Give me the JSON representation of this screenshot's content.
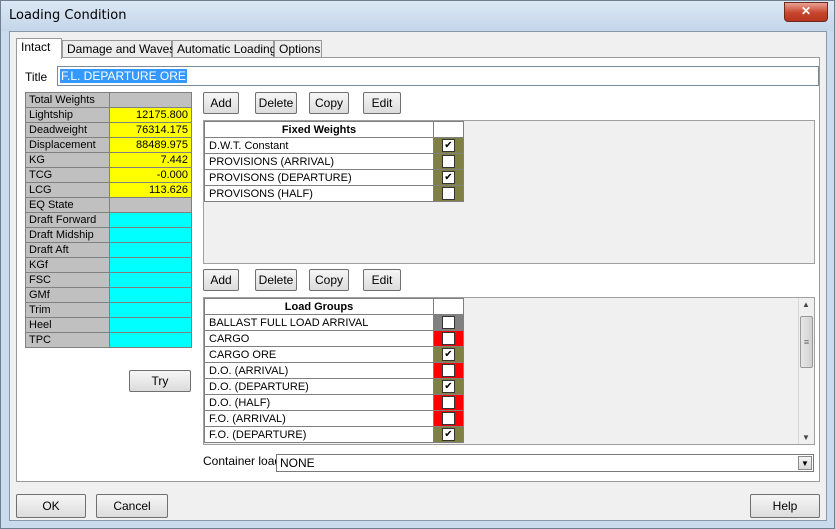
{
  "window": {
    "title": "Loading Condition",
    "close_label": "✕"
  },
  "tabs": [
    {
      "label": "Intact"
    },
    {
      "label": "Damage and Waves"
    },
    {
      "label": "Automatic Loading"
    },
    {
      "label": "Options"
    }
  ],
  "title_field": {
    "label": "Title",
    "value": "F.L. DEPARTURE ORE"
  },
  "weights": {
    "header": "Total Weights",
    "rows": [
      {
        "label": "Lightship",
        "value": "12175.800"
      },
      {
        "label": "Deadweight",
        "value": "76314.175"
      },
      {
        "label": "Displacement",
        "value": "88489.975"
      },
      {
        "label": "KG",
        "value": "7.442"
      },
      {
        "label": "TCG",
        "value": "-0.000"
      },
      {
        "label": "LCG",
        "value": "113.626"
      },
      {
        "label": "EQ State",
        "value": ""
      },
      {
        "label": "Draft Forward",
        "value": ""
      },
      {
        "label": "Draft Midship",
        "value": ""
      },
      {
        "label": "Draft Aft",
        "value": ""
      },
      {
        "label": "KGf",
        "value": ""
      },
      {
        "label": "FSC",
        "value": ""
      },
      {
        "label": "GMf",
        "value": ""
      },
      {
        "label": "Trim",
        "value": ""
      },
      {
        "label": "Heel",
        "value": ""
      },
      {
        "label": "TPC",
        "value": ""
      }
    ],
    "try_label": "Try"
  },
  "toolbar1": {
    "add": "Add",
    "delete": "Delete",
    "copy": "Copy",
    "edit": "Edit"
  },
  "toolbar2": {
    "add": "Add",
    "delete": "Delete",
    "copy": "Copy",
    "edit": "Edit"
  },
  "fixed_weights": {
    "header": "Fixed Weights",
    "rows": [
      {
        "name": "D.W.T. Constant",
        "checked": true,
        "color": "#808040"
      },
      {
        "name": "PROVISIONS (ARRIVAL)",
        "checked": false,
        "color": "#808040"
      },
      {
        "name": "PROVISONS (DEPARTURE)",
        "checked": true,
        "color": "#808040"
      },
      {
        "name": "PROVISONS (HALF)",
        "checked": false,
        "color": "#808040"
      }
    ]
  },
  "load_groups": {
    "header": "Load Groups",
    "rows": [
      {
        "name": "BALLAST FULL LOAD ARRIVAL",
        "checked": false,
        "color": "#808080"
      },
      {
        "name": "CARGO",
        "checked": false,
        "color": "#ff0000"
      },
      {
        "name": "CARGO ORE",
        "checked": true,
        "color": "#808040"
      },
      {
        "name": "D.O. (ARRIVAL)",
        "checked": false,
        "color": "#ff0000"
      },
      {
        "name": "D.O. (DEPARTURE)",
        "checked": true,
        "color": "#808040"
      },
      {
        "name": "D.O. (HALF)",
        "checked": false,
        "color": "#ff0000"
      },
      {
        "name": "F.O. (ARRIVAL)",
        "checked": false,
        "color": "#ff0000"
      },
      {
        "name": "F.O. (DEPARTURE)",
        "checked": true,
        "color": "#808040"
      }
    ]
  },
  "container_load": {
    "label": "Container load",
    "value": "NONE"
  },
  "footer": {
    "ok": "OK",
    "cancel": "Cancel",
    "help": "Help"
  }
}
